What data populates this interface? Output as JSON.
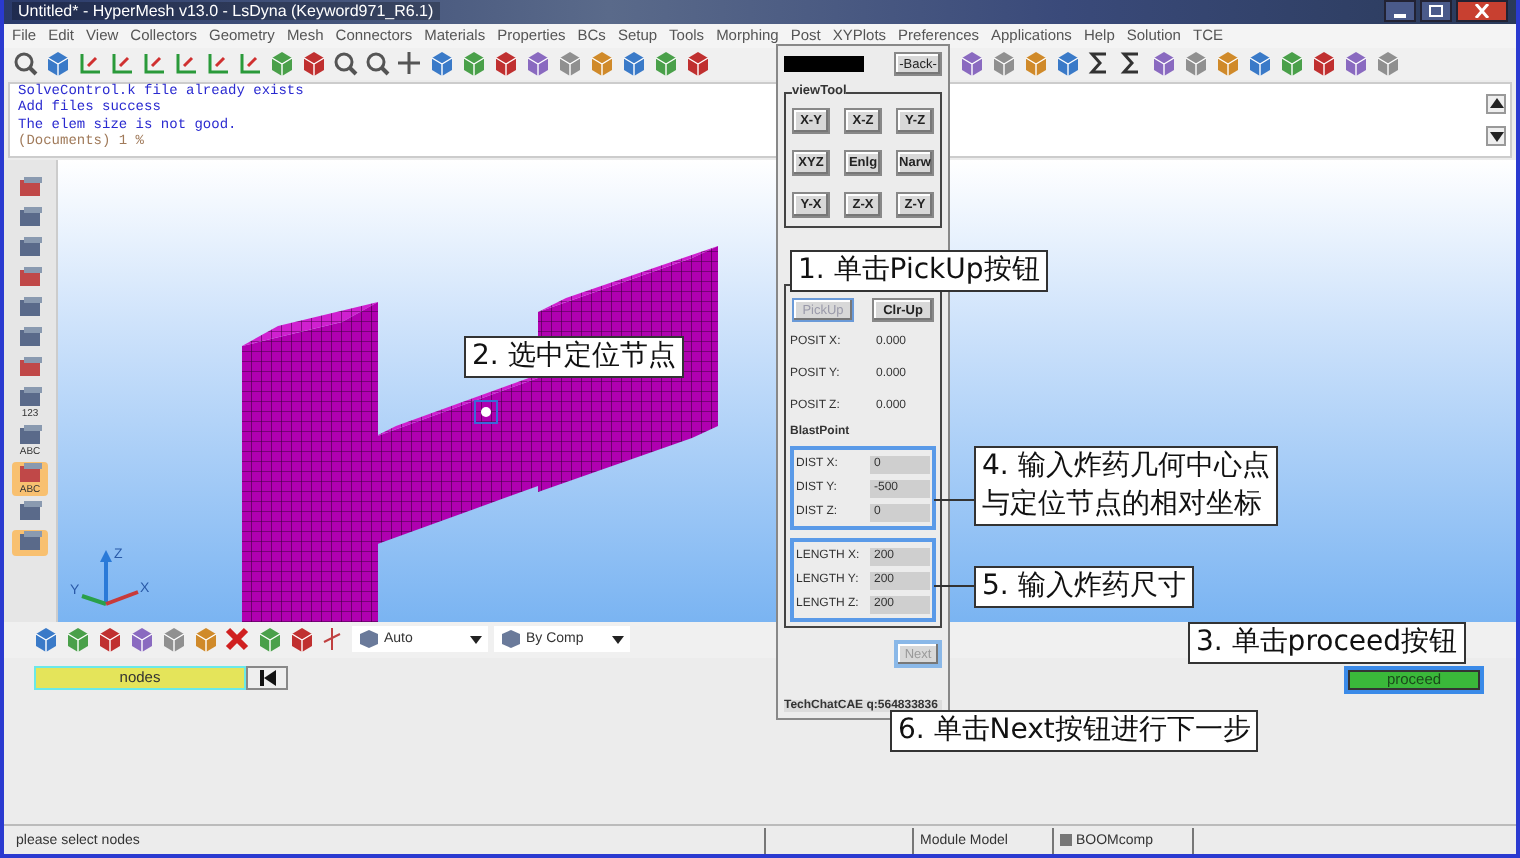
{
  "window": {
    "title": "Untitled* - HyperMesh v13.0 - LsDyna (Keyword971_R6.1)"
  },
  "menu": [
    "File",
    "Edit",
    "View",
    "Collectors",
    "Geometry",
    "Mesh",
    "Connectors",
    "Materials",
    "Properties",
    "BCs",
    "Setup",
    "Tools",
    "Morphing",
    "Post",
    "XYPlots",
    "Preferences",
    "Applications",
    "Help",
    "Solution",
    "TCE"
  ],
  "console": {
    "lines": [
      "SolveControl.k file already exists",
      "Add files success",
      "The elem size is not good."
    ],
    "prompt": "(Documents) 1 %"
  },
  "left_toolbar": [
    {
      "selected": false
    },
    {
      "selected": false
    },
    {
      "selected": false
    },
    {
      "selected": false
    },
    {
      "selected": false
    },
    {
      "selected": false
    },
    {
      "selected": false
    },
    {
      "selected": false,
      "label": "123"
    },
    {
      "selected": false,
      "label": "ABC"
    },
    {
      "selected": true,
      "label": "ABC"
    },
    {
      "selected": false
    },
    {
      "selected": true
    }
  ],
  "viewport": {
    "axes": [
      "Z",
      "Y",
      "X"
    ]
  },
  "bottom_toolbar": {
    "dropdowns": [
      "Auto",
      "By Comp"
    ]
  },
  "panel": {
    "selector": "nodes",
    "proceed": "proceed"
  },
  "dialog": {
    "back": "-Back-",
    "view_tool": {
      "title": "viewTool",
      "buttons": [
        "X-Y",
        "X-Z",
        "Y-Z",
        "XYZ",
        "Enlg",
        "Narw",
        "Y-X",
        "Z-X",
        "Z-Y"
      ]
    },
    "pick_buttons": [
      {
        "label": "PickUp",
        "disabled": true
      },
      {
        "label": "Clr-Up",
        "disabled": false
      }
    ],
    "position": [
      {
        "label": "POSIT X:",
        "value": "0.000"
      },
      {
        "label": "POSIT Y:",
        "value": "0.000"
      },
      {
        "label": "POSIT Z:",
        "value": "0.000"
      }
    ],
    "blast_label": "BlastPoint",
    "distance": [
      {
        "label": "DIST X:",
        "value": "0"
      },
      {
        "label": "DIST Y:",
        "value": "-500"
      },
      {
        "label": "DIST Z:",
        "value": "0"
      }
    ],
    "length": [
      {
        "label": "LENGTH X:",
        "value": "200"
      },
      {
        "label": "LENGTH Y:",
        "value": "200"
      },
      {
        "label": "LENGTH Z:",
        "value": "200"
      }
    ],
    "next": {
      "label": "Next",
      "disabled": true
    },
    "footer": "TechChatCAE q:564833836"
  },
  "annotations": [
    {
      "lines": [
        "1. 单击PickUp按钮"
      ]
    },
    {
      "lines": [
        "2. 选中定位节点"
      ]
    },
    {
      "lines": [
        "3. 单击proceed按钮"
      ]
    },
    {
      "lines": [
        "4. 输入炸药几何中心点",
        "与定位节点的相对坐标"
      ]
    },
    {
      "lines": [
        "5. 输入炸药尺寸"
      ]
    },
    {
      "lines": [
        "6. 单击Next按钮进行下一步"
      ]
    }
  ],
  "status_bar": {
    "message": "please select nodes",
    "cells": [
      "Module Model",
      "BOOMcomp"
    ]
  }
}
